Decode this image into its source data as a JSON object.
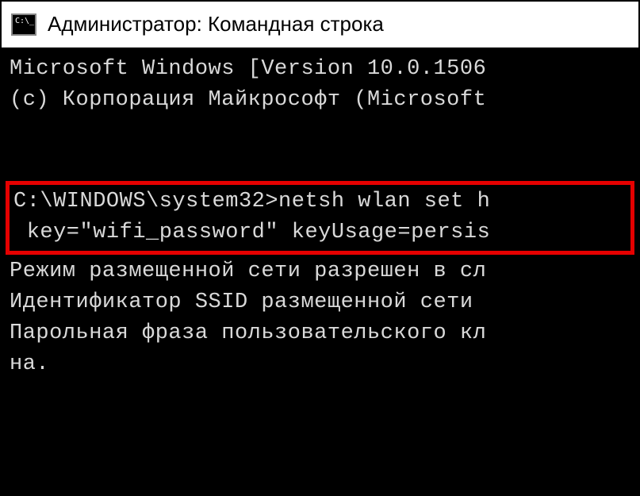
{
  "window": {
    "title": "Администратор: Командная строка"
  },
  "terminal": {
    "lines": {
      "version": "Microsoft Windows [Version 10.0.1506",
      "copyright": "(с) Корпорация Майкрософт (Microsoft",
      "cmd1": "C:\\WINDOWS\\system32>netsh wlan set h",
      "cmd2": " key=\"wifi_password\" keyUsage=persis",
      "out1": "Режим размещенной сети разрешен в сл",
      "out2": "Идентификатор SSID размещенной сети ",
      "out3": "Парольная фраза пользовательского кл",
      "out4": "на."
    }
  }
}
